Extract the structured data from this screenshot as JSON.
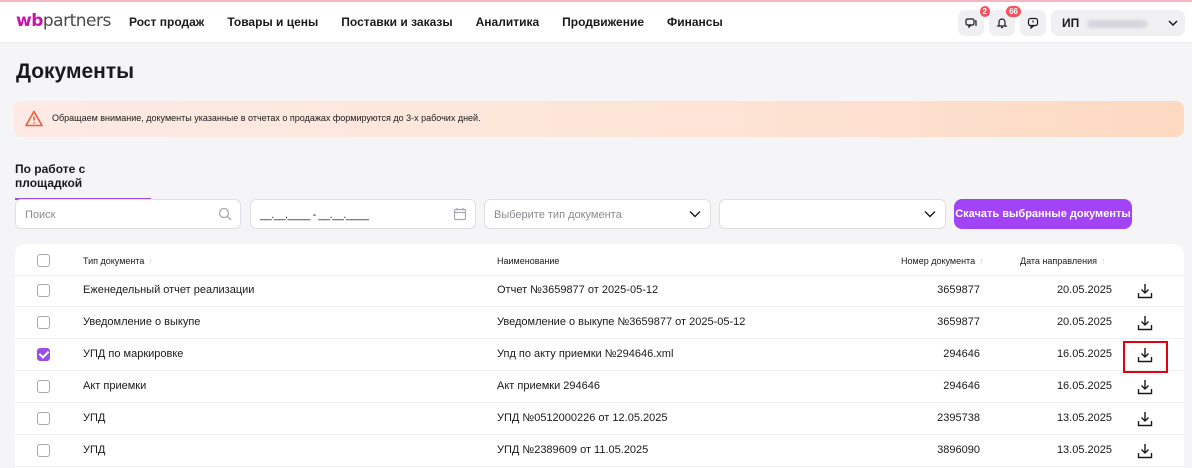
{
  "header": {
    "logo_wb": "wb",
    "logo_partners": "partners",
    "nav": [
      "Рост продаж",
      "Товары и цены",
      "Поставки и заказы",
      "Аналитика",
      "Продвижение",
      "Финансы"
    ],
    "chat_badge": "2",
    "notifications_badge": "66",
    "user_prefix": "ИП"
  },
  "page": {
    "title": "Документы",
    "alert": "Обращаем внимание, документы указанные в отчетах о продажах формируются до 3-х рабочих дней.",
    "tab": "По работе с площадкой"
  },
  "filters": {
    "search_placeholder": "Поиск",
    "date_range": "__.__.____ - __.__.____",
    "doc_type_placeholder": "Выберите тип документа",
    "download_selected": "Скачать выбранные документы"
  },
  "table": {
    "columns": {
      "type": "Тип документа",
      "name": "Наименование",
      "number": "Номер документа",
      "date": "Дата направления"
    },
    "rows": [
      {
        "type": "Еженедельный отчет реализации",
        "name": "Отчет №3659877 от 2025-05-12",
        "number": "3659877",
        "date": "20.05.2025",
        "checked": false
      },
      {
        "type": "Уведомление о выкупе",
        "name": "Уведомление о выкупе №3659877 от 2025-05-12",
        "number": "3659877",
        "date": "20.05.2025",
        "checked": false
      },
      {
        "type": "УПД по маркировке",
        "name": "Упд по акту приемки №294646.xml",
        "number": "294646",
        "date": "16.05.2025",
        "checked": true
      },
      {
        "type": "Акт приемки",
        "name": "Акт приемки 294646",
        "number": "294646",
        "date": "16.05.2025",
        "checked": false
      },
      {
        "type": "УПД",
        "name": "УПД №0512000226 от 12.05.2025",
        "number": "2395738",
        "date": "13.05.2025",
        "checked": false
      },
      {
        "type": "УПД",
        "name": "УПД №2389609 от 11.05.2025",
        "number": "3896090",
        "date": "13.05.2025",
        "checked": false
      }
    ]
  },
  "colors": {
    "accent": "#a244f5",
    "brand": "#cb11ab",
    "highlight": "#e3000f"
  }
}
